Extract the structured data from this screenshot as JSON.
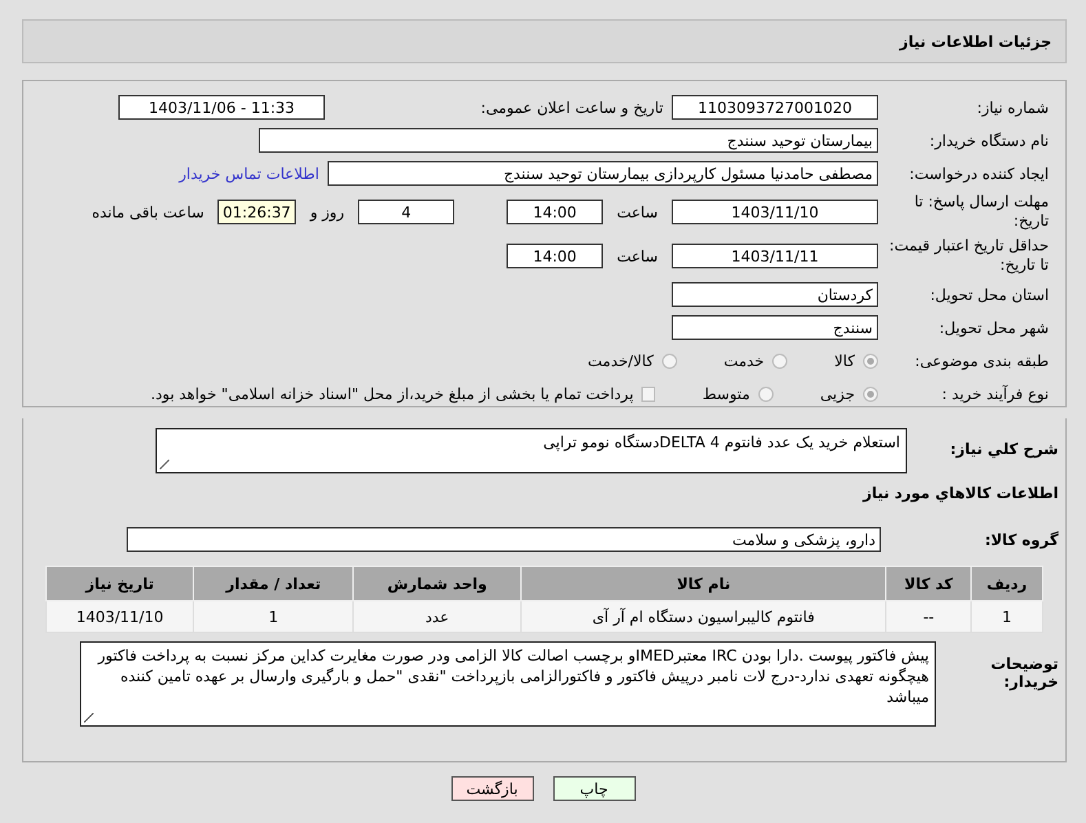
{
  "header": {
    "title": "جزئیات اطلاعات نیاز"
  },
  "need_number": {
    "label": "شماره نیاز:",
    "value": "1103093727001020"
  },
  "announce": {
    "label": "تاریخ و ساعت اعلان عمومی:",
    "value": "1403/11/06 - 11:33"
  },
  "buyer_org": {
    "label": "نام دستگاه خریدار:",
    "value": "بیمارستان توحید سنندج"
  },
  "creator": {
    "label": "ایجاد کننده درخواست:",
    "value": "مصطفی حامدنیا مسئول کارپردازی بیمارستان توحید سنندج",
    "link": "اطلاعات تماس خریدار"
  },
  "response_deadline": {
    "label": "مهلت ارسال پاسخ: تا تاریخ:",
    "date": "1403/11/10",
    "time_label": "ساعت",
    "time": "14:00",
    "days": "4",
    "days_label": "روز و",
    "remaining": "01:26:37",
    "remaining_label": "ساعت باقی مانده"
  },
  "price_validity": {
    "label": "حداقل تاریخ اعتبار قیمت: تا تاریخ:",
    "date": "1403/11/11",
    "time_label": "ساعت",
    "time": "14:00"
  },
  "province": {
    "label": "استان محل تحویل:",
    "value": "کردستان"
  },
  "city": {
    "label": "شهر محل تحویل:",
    "value": "سنندج"
  },
  "category": {
    "label": "طبقه بندی موضوعی:",
    "options": [
      {
        "label": "کالا",
        "selected": true
      },
      {
        "label": "خدمت",
        "selected": false
      },
      {
        "label": "کالا/خدمت",
        "selected": false
      }
    ]
  },
  "purchase_process": {
    "label": "نوع فرآیند خرید :",
    "options": [
      {
        "label": "جزیی",
        "selected": true
      },
      {
        "label": "متوسط",
        "selected": false
      }
    ],
    "treasury": {
      "checked": false,
      "label": "پرداخت تمام یا بخشی از مبلغ خرید،از محل \"اسناد خزانه اسلامی\" خواهد بود."
    }
  },
  "summary": {
    "label": "شرح کلي نياز:",
    "value": "استعلام خرید یک عدد فانتوم  DELTA 4دستگاه نومو تراپی"
  },
  "items_title": "اطلاعات کالاهاي مورد نياز",
  "goods_group": {
    "label": "گروه کالا:",
    "value": "دارو، پزشکی و سلامت"
  },
  "table": {
    "columns": [
      "ردیف",
      "کد کالا",
      "نام کالا",
      "واحد شمارش",
      "تعداد / مقدار",
      "تاریخ نیاز"
    ],
    "rows": [
      [
        "1",
        "--",
        "فانتوم کالیبراسیون دستگاه ام آر آی",
        "عدد",
        "1",
        "1403/11/10"
      ]
    ]
  },
  "buyer_notes": {
    "label": "توضیحات خریدار:",
    "value": "پیش فاکتور پیوست .دارا بودن IRC معتبرIMEDو برچسب اصالت کالا الزامی ودر صورت مغایرت کداین مرکز نسبت به پرداخت فاکتور هیچگونه تعهدی ندارد-درج لات نامبر درپیش فاکتور و فاکتورالزامی  بازپرداخت \"نقدی \"حمل و بارگیری وارسال بر عهده تامین کننده میباشد"
  },
  "buttons": [
    {
      "label": "چاپ",
      "kind": "print"
    },
    {
      "label": "بازگشت",
      "kind": "back"
    }
  ]
}
